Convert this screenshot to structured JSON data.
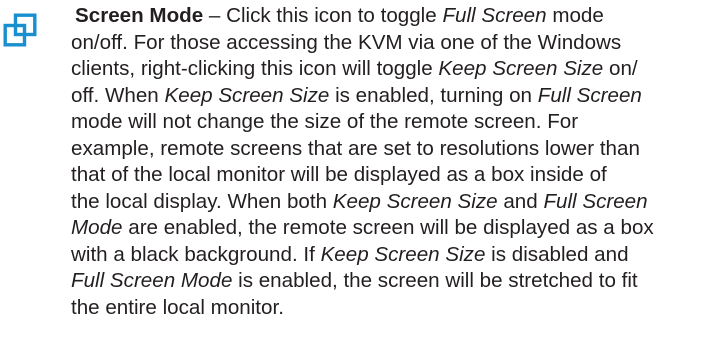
{
  "entry": {
    "icon": "screen-mode-icon",
    "icon_color": "#1a8fd0",
    "title": "Screen Mode",
    "dash": " – ",
    "lines": [
      [
        {
          "t": "Click this icon to toggle ",
          "s": "normal"
        },
        {
          "t": "Full Screen",
          "s": "italic"
        },
        {
          "t": " mode",
          "s": "normal"
        }
      ],
      [
        {
          "t": "on/off. For those accessing the KVM via one of the Windows",
          "s": "normal"
        }
      ],
      [
        {
          "t": "clients, right-clicking this icon will toggle ",
          "s": "normal"
        },
        {
          "t": "Keep Screen Size",
          "s": "italic"
        },
        {
          "t": " on/",
          "s": "normal"
        }
      ],
      [
        {
          "t": "off. When ",
          "s": "normal"
        },
        {
          "t": "Keep Screen Size",
          "s": "italic"
        },
        {
          "t": " is enabled, turning on ",
          "s": "normal"
        },
        {
          "t": "Full Screen",
          "s": "italic"
        }
      ],
      [
        {
          "t": "mode will not change the size of the remote screen. For",
          "s": "normal"
        }
      ],
      [
        {
          "t": "example, remote screens that are set to resolutions lower than",
          "s": "normal"
        }
      ],
      [
        {
          "t": "that of the local monitor will be displayed as a box inside of",
          "s": "normal"
        }
      ],
      [
        {
          "t": "the local display. When both ",
          "s": "normal"
        },
        {
          "t": "Keep Screen Size",
          "s": "italic"
        },
        {
          "t": " and ",
          "s": "normal"
        },
        {
          "t": "Full Screen",
          "s": "italic"
        }
      ],
      [
        {
          "t": "Mode",
          "s": "italic"
        },
        {
          "t": " are enabled, the remote screen will be displayed as a box",
          "s": "normal"
        }
      ],
      [
        {
          "t": "with a black background. If ",
          "s": "normal"
        },
        {
          "t": "Keep Screen Size",
          "s": "italic"
        },
        {
          "t": " is disabled and",
          "s": "normal"
        }
      ],
      [
        {
          "t": "Full Screen Mode",
          "s": "italic"
        },
        {
          "t": " is enabled, the screen will be stretched to fit",
          "s": "normal"
        }
      ],
      [
        {
          "t": "the entire local monitor.",
          "s": "normal"
        }
      ]
    ]
  }
}
